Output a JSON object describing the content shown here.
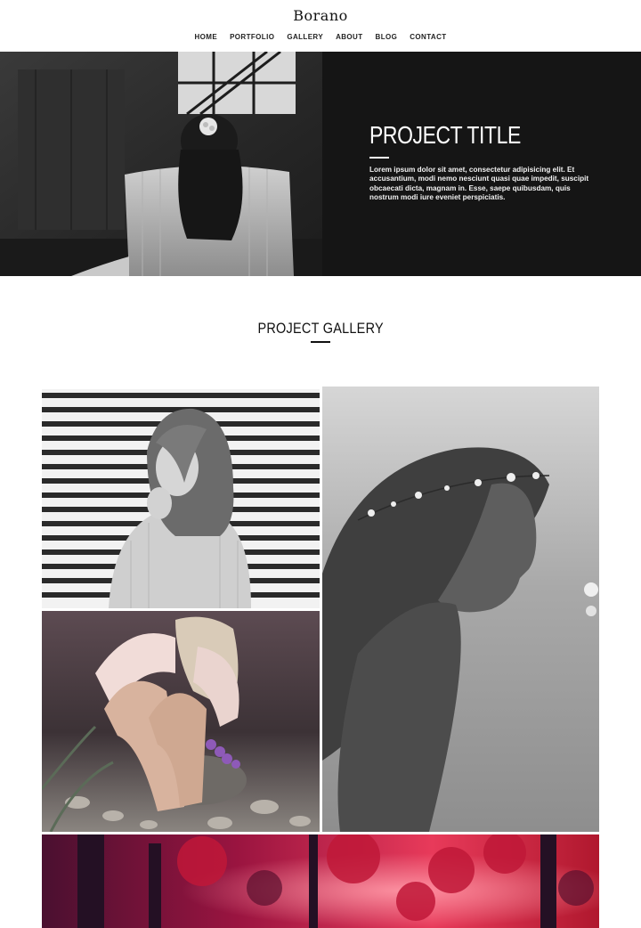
{
  "site": {
    "logo": "Borano"
  },
  "nav": {
    "items": [
      "HOME",
      "PORTFOLIO",
      "GALLERY",
      "ABOUT",
      "BLOG",
      "CONTACT"
    ]
  },
  "hero": {
    "title": "PROJECT TITLE",
    "description": "Lorem ipsum dolor sit amet, consectetur adipisicing elit. Et accusantium, modi nemo nesciunt quasi quae impedit, suscipit obcaecati dicta, magnam in. Esse, saepe quibusdam, quis nostrum modi iure eveniet perspiciatis."
  },
  "gallery": {
    "title": "PROJECT GALLERY"
  },
  "colors": {
    "hero_bg": "#151515",
    "page_bg": "#ffffff",
    "text_dark": "#111111"
  }
}
